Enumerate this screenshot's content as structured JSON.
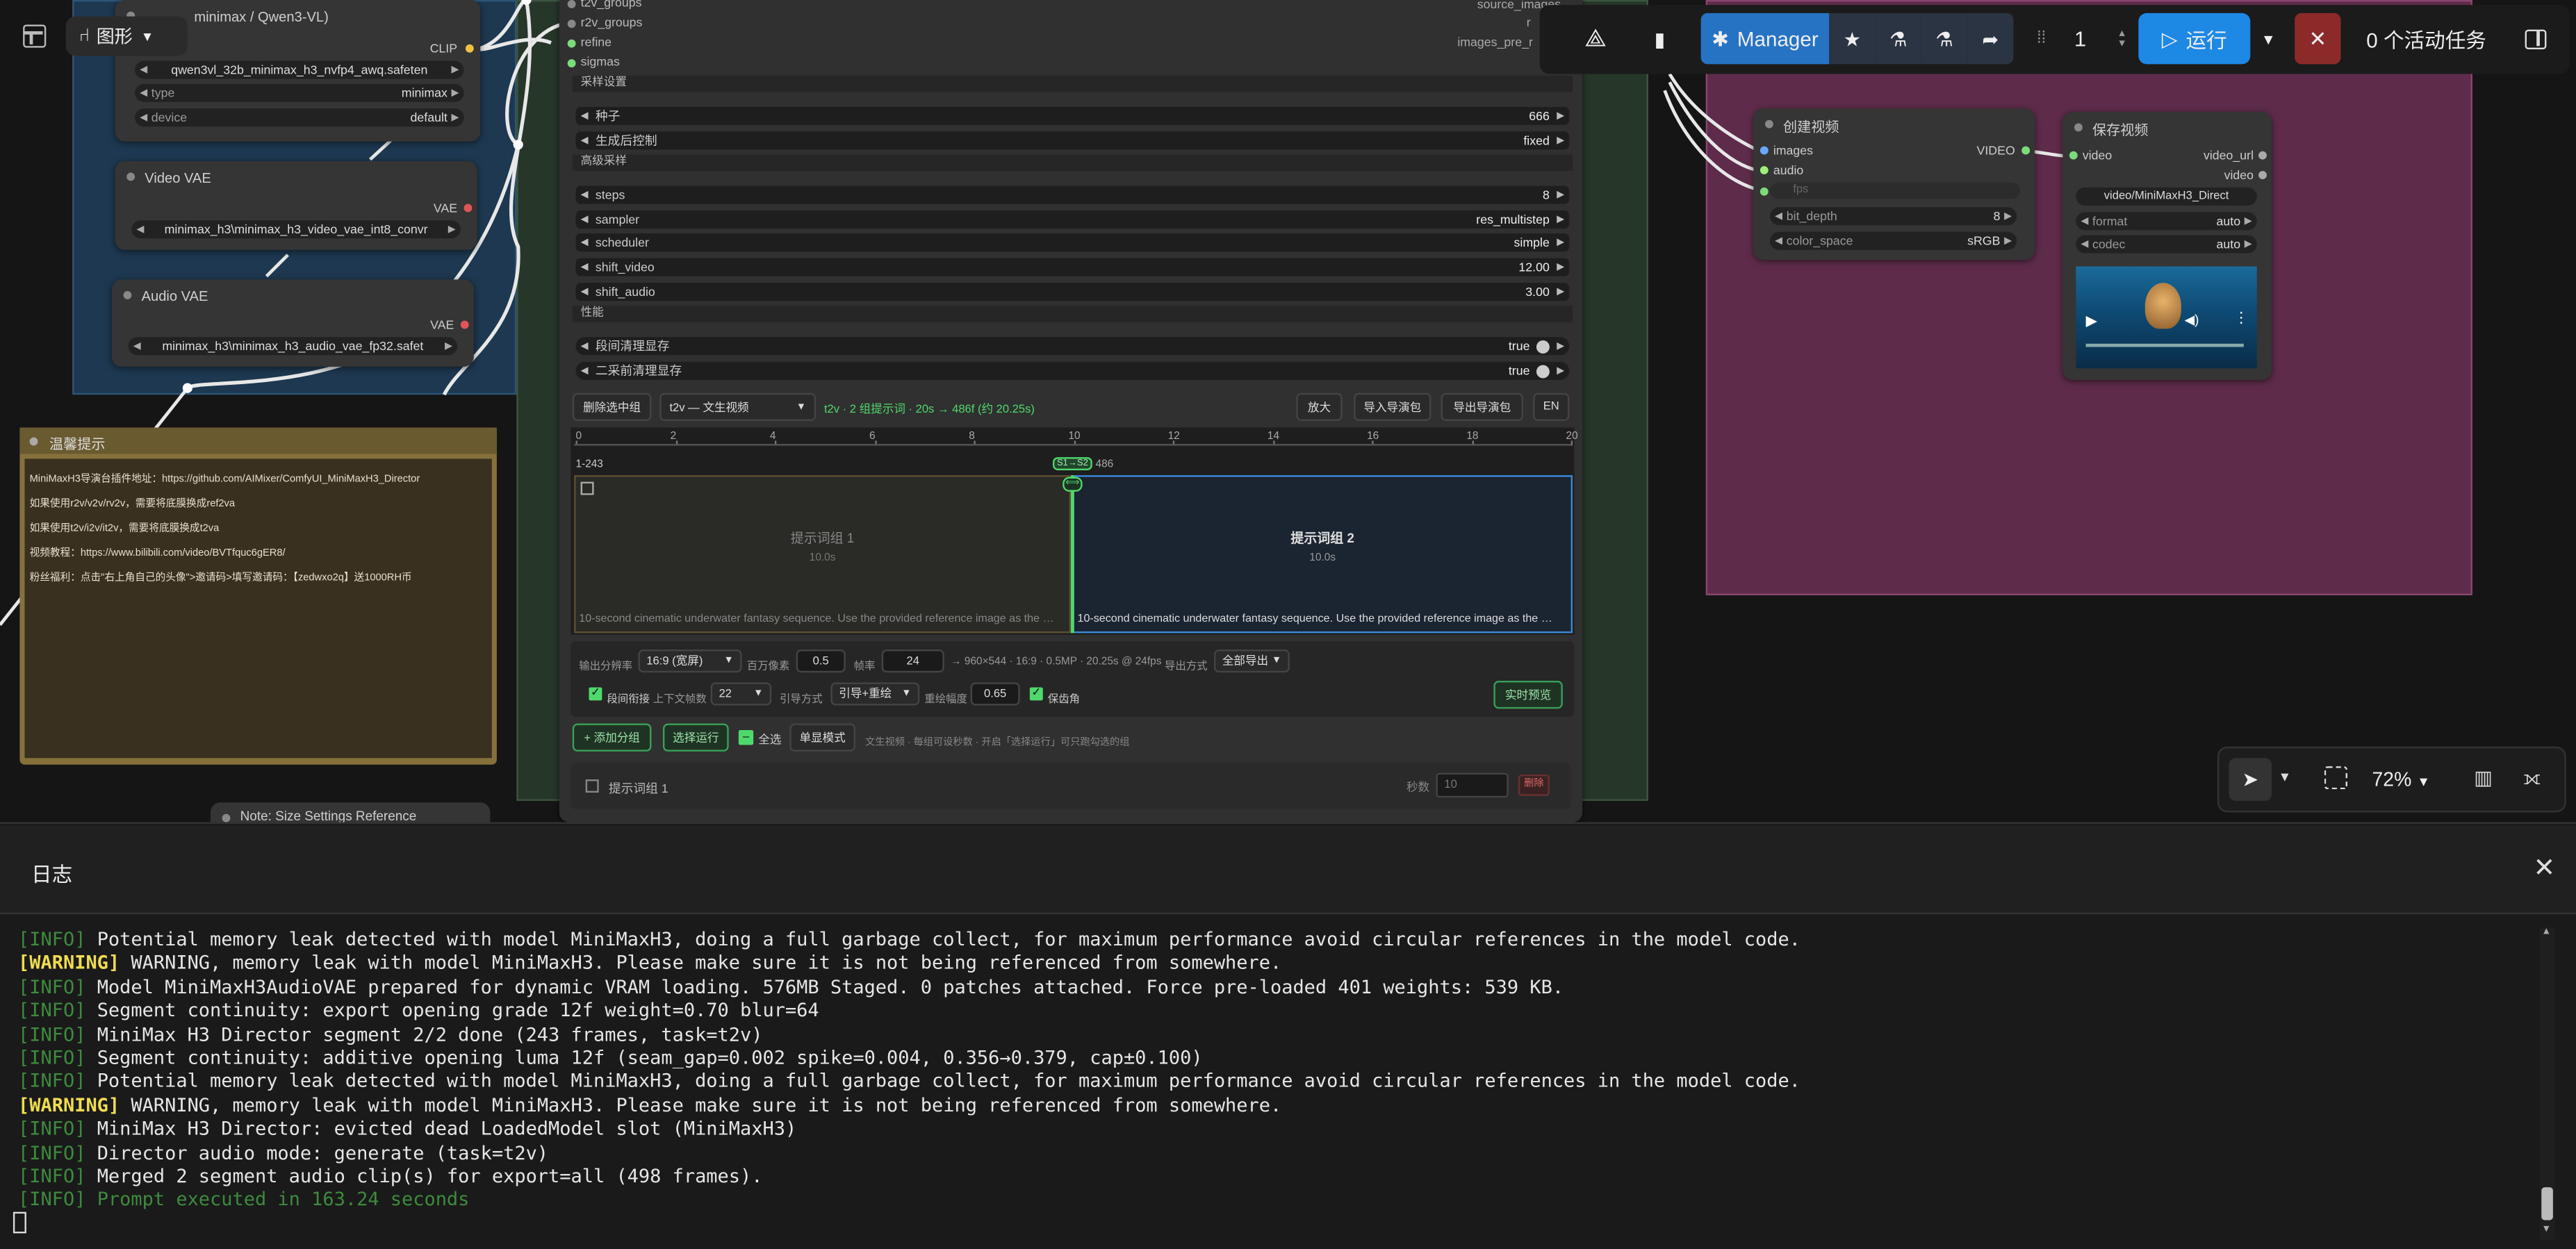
{
  "canvas": {
    "view_label": "图形"
  },
  "node_clip": {
    "title": "minimax / Qwen3-VL)",
    "out": "CLIP",
    "model": "qwen3vl_32b_minimax_h3_nvfp4_awq.safeten",
    "type_label": "type",
    "type_value": "minimax",
    "device_label": "device",
    "device_value": "default"
  },
  "node_vvae": {
    "title": "Video VAE",
    "out": "VAE",
    "file": "minimax_h3\\minimax_h3_video_vae_int8_convr"
  },
  "node_avae": {
    "title": "Audio VAE",
    "out": "VAE",
    "file": "minimax_h3\\minimax_h3_audio_vae_fp32.safet"
  },
  "tips": {
    "title": "温馨提示",
    "lines": [
      "MiniMaxH3导演台插件地址：https://github.com/AIMixer/ComfyUI_MiniMaxH3_Director",
      "如果使用r2v/v2v/rv2v，需要将底膜换成ref2va",
      "如果使用t2v/i2v/it2v，需要将底膜换成t2va",
      "视频教程：https://www.bilibili.com/video/BVTfquc6gER8/",
      "粉丝福利：点击\"右上角自己的头像\">邀请码>填写邀请码：【zedwxo2q】送1000RH币"
    ]
  },
  "note_title": "Note: Size Settings Reference",
  "director": {
    "inputs": [
      "t2v_groups",
      "r2v_groups",
      "refine",
      "sigmas"
    ],
    "outputs": [
      "source_images",
      "r",
      "images_pre_r"
    ],
    "sec_sampling": "采样设置",
    "seed_label": "种子",
    "seed_value": "666",
    "control_label": "生成后控制",
    "control_value": "fixed",
    "sec_advanced": "高级采样",
    "steps_label": "steps",
    "steps_value": "8",
    "sampler_label": "sampler",
    "sampler_value": "res_multistep",
    "scheduler_label": "scheduler",
    "scheduler_value": "simple",
    "shiftv_label": "shift_video",
    "shiftv_value": "12.00",
    "shifta_label": "shift_audio",
    "shifta_value": "3.00",
    "sec_perf": "性能",
    "clean1_label": "段间清理显存",
    "clean1_value": "true",
    "clean2_label": "二采前清理显存",
    "clean2_value": "true",
    "btn_delete": "删除选中组",
    "mode_select": "t2v — 文生视频",
    "summary": "t2v · 2 组提示词 · 20s → 486f (约 20.25s)",
    "btn_zoom": "放大",
    "btn_import": "导入导演包",
    "btn_export": "导出导演包",
    "btn_lang": "EN",
    "ruler": [
      "0",
      "2",
      "4",
      "6",
      "8",
      "10",
      "12",
      "14",
      "16",
      "18",
      "20"
    ],
    "range_left": "1-243",
    "marker": "S1→S2",
    "range_right": "486",
    "seg1_title": "提示词组 1",
    "seg1_dur": "10.0s",
    "seg1_text": "10-second cinematic underwater fantasy sequence. Use the provided reference image as the …",
    "seg2_title": "提示词组 2",
    "seg2_dur": "10.0s",
    "seg2_text": "10-second cinematic underwater fantasy sequence. Use the provided reference image as the …",
    "res_label": "输出分辨率",
    "res_value": "16:9 (宽屏)",
    "mp_label": "百万像素",
    "mp_value": "0.5",
    "fps_label": "帧率",
    "fps_value": "24",
    "res_info": "→ 960×544 · 16:9 · 0.5MP · 20.25s @ 24fps",
    "export_label": "导出方式",
    "export_value": "全部导出",
    "cont_label": "段间衔接",
    "ctx_label": "上下文帧数",
    "ctx_value": "22",
    "guide_label": "引导方式",
    "guide_value": "引导+重绘",
    "overlap_label": "重绘幅度",
    "overlap_value": "0.65",
    "keep_label": "保齿角",
    "btn_preview": "实时预览",
    "btn_add": "+ 添加分组",
    "btn_run_sel": "选择运行",
    "select_all": "全选",
    "btn_single": "单显模式",
    "hint": "文生视频 · 每组可设秒数 · 开启「选择运行」可只跑勾选的组",
    "group1_label": "提示词组 1",
    "sec_label": "秒数",
    "sec_value": "10",
    "btn_del": "删除"
  },
  "node_create": {
    "title": "创建视频",
    "in1": "images",
    "in2": "audio",
    "in3": "fps",
    "out": "VIDEO",
    "w1_label": "bit_depth",
    "w1_value": "8",
    "w2_label": "color_space",
    "w2_value": "sRGB"
  },
  "node_save": {
    "title": "保存视频",
    "in": "video",
    "out1": "video_url",
    "out2": "video",
    "file": "video/MiniMaxH3_Direct",
    "fmt_label": "format",
    "fmt_value": "auto",
    "codec_label": "codec",
    "codec_value": "auto"
  },
  "toolbar": {
    "manager": "Manager",
    "queue_count": "1",
    "run": "运行",
    "tasks": "0 个活动任务"
  },
  "zoom": {
    "level": "72%"
  },
  "log_panel": {
    "title": "日志",
    "lines": [
      {
        "tag": "[INFO]",
        "kind": "info",
        "text": " Potential memory leak detected with model MiniMaxH3, doing a full garbage collect, for maximum performance avoid circular references in the model code."
      },
      {
        "tag": "[WARNING]",
        "kind": "warn",
        "text": " WARNING, memory leak with model MiniMaxH3. Please make sure it is not being referenced from somewhere."
      },
      {
        "tag": "[INFO]",
        "kind": "info",
        "text": " Model MiniMaxH3AudioVAE prepared for dynamic VRAM loading. 576MB Staged. 0 patches attached. Force pre-loaded 401 weights: 539 KB."
      },
      {
        "tag": "[INFO]",
        "kind": "info",
        "text": " Segment continuity: export opening grade 12f weight=0.70 blur=64"
      },
      {
        "tag": "[INFO]",
        "kind": "info",
        "text": " MiniMax H3 Director segment 2/2 done (243 frames, task=t2v)"
      },
      {
        "tag": "[INFO]",
        "kind": "info",
        "text": " Segment continuity: additive opening luma 12f (seam_gap=0.002 spike=0.004, 0.356→0.379, cap±0.100)"
      },
      {
        "tag": "[INFO]",
        "kind": "info",
        "text": " Potential memory leak detected with model MiniMaxH3, doing a full garbage collect, for maximum performance avoid circular references in the model code."
      },
      {
        "tag": "[WARNING]",
        "kind": "warn",
        "text": " WARNING, memory leak with model MiniMaxH3. Please make sure it is not being referenced from somewhere."
      },
      {
        "tag": "[INFO]",
        "kind": "info",
        "text": " MiniMax H3 Director: evicted dead LoadedModel slot (MiniMaxH3)"
      },
      {
        "tag": "[INFO]",
        "kind": "info",
        "text": " Director audio mode: generate (task=t2v)"
      },
      {
        "tag": "[INFO]",
        "kind": "info",
        "text": " Merged 2 segment audio clip(s) for export=all (498 frames)."
      },
      {
        "tag": "[INFO]",
        "kind": "info",
        "text": " Prompt executed in 163.24 seconds"
      }
    ]
  },
  "colors": {
    "accent": "#1e7fd6",
    "node": "#353535",
    "pink_group": "#5a2a48",
    "blue_group": "#1c3a55",
    "green_group": "#2a3a2c",
    "tips": "#856f3a"
  }
}
